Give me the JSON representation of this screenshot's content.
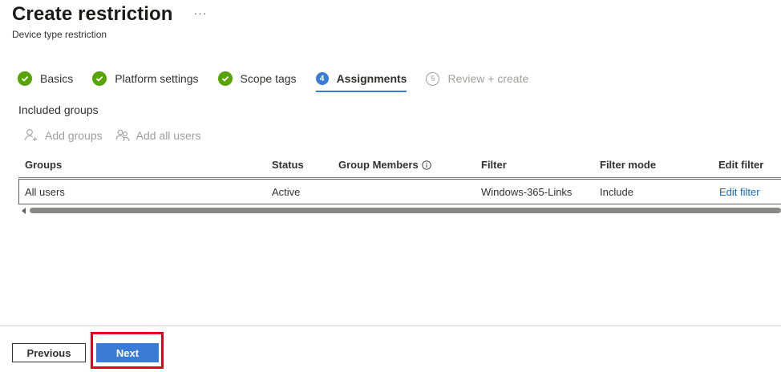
{
  "header": {
    "title": "Create restriction",
    "more_label": "···",
    "subtitle": "Device type restriction"
  },
  "steps": [
    {
      "label": "Basics",
      "state": "done",
      "number": ""
    },
    {
      "label": "Platform settings",
      "state": "done",
      "number": ""
    },
    {
      "label": "Scope tags",
      "state": "done",
      "number": ""
    },
    {
      "label": "Assignments",
      "state": "current",
      "number": "4"
    },
    {
      "label": "Review + create",
      "state": "todo",
      "number": "5"
    }
  ],
  "section": {
    "title": "Included groups"
  },
  "actions": {
    "add_groups": "Add groups",
    "add_all_users": "Add all users"
  },
  "table": {
    "headers": [
      "Groups",
      "Status",
      "Group Members",
      "Filter",
      "Filter mode",
      "Edit filter"
    ],
    "rows": [
      {
        "group": "All users",
        "status": "Active",
        "members": "",
        "filter": "Windows-365-Links",
        "filter_mode": "Include",
        "edit_filter": "Edit filter"
      }
    ]
  },
  "footer": {
    "previous": "Previous",
    "next": "Next"
  },
  "colors": {
    "done": "#57a300",
    "accent": "#3a7bd5",
    "link": "#0f6cbd",
    "highlight": "#e4001a"
  }
}
